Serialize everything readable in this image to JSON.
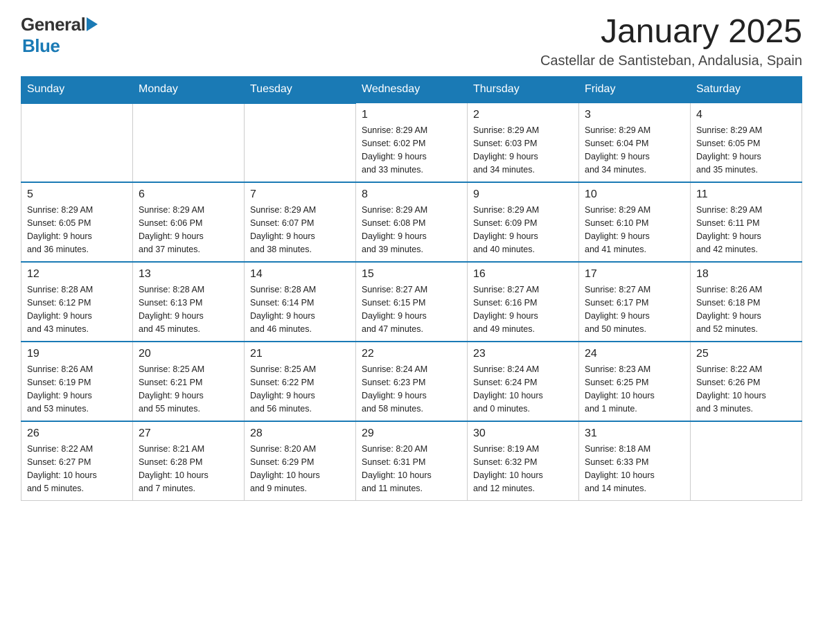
{
  "header": {
    "logo_general": "General",
    "logo_blue": "Blue",
    "month_year": "January 2025",
    "location": "Castellar de Santisteban, Andalusia, Spain"
  },
  "days_of_week": [
    "Sunday",
    "Monday",
    "Tuesday",
    "Wednesday",
    "Thursday",
    "Friday",
    "Saturday"
  ],
  "weeks": [
    {
      "days": [
        {
          "num": "",
          "info": ""
        },
        {
          "num": "",
          "info": ""
        },
        {
          "num": "",
          "info": ""
        },
        {
          "num": "1",
          "info": "Sunrise: 8:29 AM\nSunset: 6:02 PM\nDaylight: 9 hours\nand 33 minutes."
        },
        {
          "num": "2",
          "info": "Sunrise: 8:29 AM\nSunset: 6:03 PM\nDaylight: 9 hours\nand 34 minutes."
        },
        {
          "num": "3",
          "info": "Sunrise: 8:29 AM\nSunset: 6:04 PM\nDaylight: 9 hours\nand 34 minutes."
        },
        {
          "num": "4",
          "info": "Sunrise: 8:29 AM\nSunset: 6:05 PM\nDaylight: 9 hours\nand 35 minutes."
        }
      ]
    },
    {
      "days": [
        {
          "num": "5",
          "info": "Sunrise: 8:29 AM\nSunset: 6:05 PM\nDaylight: 9 hours\nand 36 minutes."
        },
        {
          "num": "6",
          "info": "Sunrise: 8:29 AM\nSunset: 6:06 PM\nDaylight: 9 hours\nand 37 minutes."
        },
        {
          "num": "7",
          "info": "Sunrise: 8:29 AM\nSunset: 6:07 PM\nDaylight: 9 hours\nand 38 minutes."
        },
        {
          "num": "8",
          "info": "Sunrise: 8:29 AM\nSunset: 6:08 PM\nDaylight: 9 hours\nand 39 minutes."
        },
        {
          "num": "9",
          "info": "Sunrise: 8:29 AM\nSunset: 6:09 PM\nDaylight: 9 hours\nand 40 minutes."
        },
        {
          "num": "10",
          "info": "Sunrise: 8:29 AM\nSunset: 6:10 PM\nDaylight: 9 hours\nand 41 minutes."
        },
        {
          "num": "11",
          "info": "Sunrise: 8:29 AM\nSunset: 6:11 PM\nDaylight: 9 hours\nand 42 minutes."
        }
      ]
    },
    {
      "days": [
        {
          "num": "12",
          "info": "Sunrise: 8:28 AM\nSunset: 6:12 PM\nDaylight: 9 hours\nand 43 minutes."
        },
        {
          "num": "13",
          "info": "Sunrise: 8:28 AM\nSunset: 6:13 PM\nDaylight: 9 hours\nand 45 minutes."
        },
        {
          "num": "14",
          "info": "Sunrise: 8:28 AM\nSunset: 6:14 PM\nDaylight: 9 hours\nand 46 minutes."
        },
        {
          "num": "15",
          "info": "Sunrise: 8:27 AM\nSunset: 6:15 PM\nDaylight: 9 hours\nand 47 minutes."
        },
        {
          "num": "16",
          "info": "Sunrise: 8:27 AM\nSunset: 6:16 PM\nDaylight: 9 hours\nand 49 minutes."
        },
        {
          "num": "17",
          "info": "Sunrise: 8:27 AM\nSunset: 6:17 PM\nDaylight: 9 hours\nand 50 minutes."
        },
        {
          "num": "18",
          "info": "Sunrise: 8:26 AM\nSunset: 6:18 PM\nDaylight: 9 hours\nand 52 minutes."
        }
      ]
    },
    {
      "days": [
        {
          "num": "19",
          "info": "Sunrise: 8:26 AM\nSunset: 6:19 PM\nDaylight: 9 hours\nand 53 minutes."
        },
        {
          "num": "20",
          "info": "Sunrise: 8:25 AM\nSunset: 6:21 PM\nDaylight: 9 hours\nand 55 minutes."
        },
        {
          "num": "21",
          "info": "Sunrise: 8:25 AM\nSunset: 6:22 PM\nDaylight: 9 hours\nand 56 minutes."
        },
        {
          "num": "22",
          "info": "Sunrise: 8:24 AM\nSunset: 6:23 PM\nDaylight: 9 hours\nand 58 minutes."
        },
        {
          "num": "23",
          "info": "Sunrise: 8:24 AM\nSunset: 6:24 PM\nDaylight: 10 hours\nand 0 minutes."
        },
        {
          "num": "24",
          "info": "Sunrise: 8:23 AM\nSunset: 6:25 PM\nDaylight: 10 hours\nand 1 minute."
        },
        {
          "num": "25",
          "info": "Sunrise: 8:22 AM\nSunset: 6:26 PM\nDaylight: 10 hours\nand 3 minutes."
        }
      ]
    },
    {
      "days": [
        {
          "num": "26",
          "info": "Sunrise: 8:22 AM\nSunset: 6:27 PM\nDaylight: 10 hours\nand 5 minutes."
        },
        {
          "num": "27",
          "info": "Sunrise: 8:21 AM\nSunset: 6:28 PM\nDaylight: 10 hours\nand 7 minutes."
        },
        {
          "num": "28",
          "info": "Sunrise: 8:20 AM\nSunset: 6:29 PM\nDaylight: 10 hours\nand 9 minutes."
        },
        {
          "num": "29",
          "info": "Sunrise: 8:20 AM\nSunset: 6:31 PM\nDaylight: 10 hours\nand 11 minutes."
        },
        {
          "num": "30",
          "info": "Sunrise: 8:19 AM\nSunset: 6:32 PM\nDaylight: 10 hours\nand 12 minutes."
        },
        {
          "num": "31",
          "info": "Sunrise: 8:18 AM\nSunset: 6:33 PM\nDaylight: 10 hours\nand 14 minutes."
        },
        {
          "num": "",
          "info": ""
        }
      ]
    }
  ]
}
